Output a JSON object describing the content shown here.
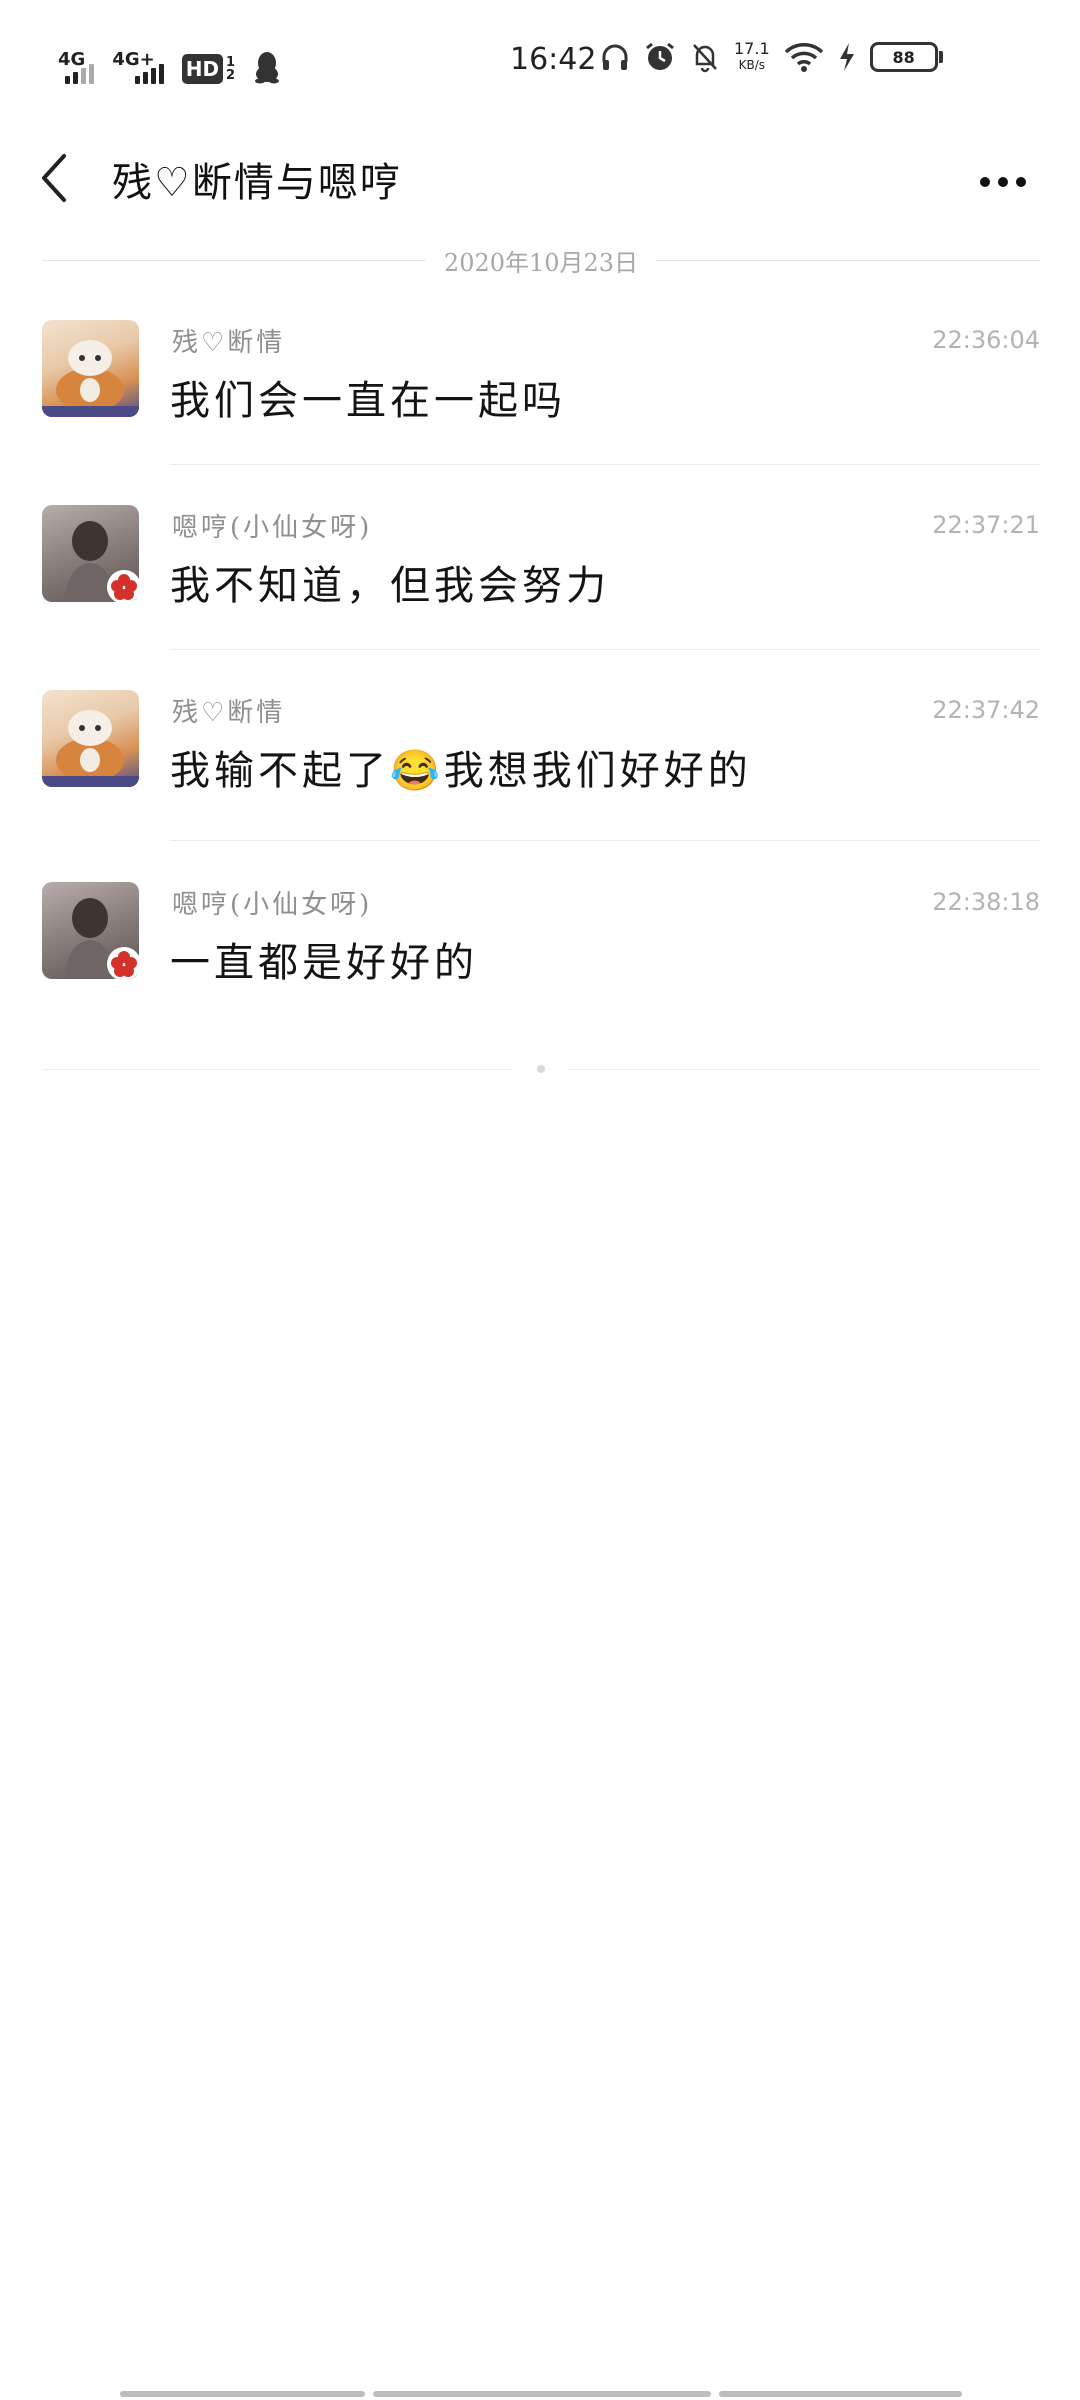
{
  "status_bar": {
    "sim1_label": "4G",
    "sim2_label": "4G+",
    "hd_label": "HD",
    "hd_sub_top": "1",
    "hd_sub_bottom": "2",
    "time": "16:42",
    "speed_value": "17.1",
    "speed_unit": "KB/s",
    "battery_level": "88"
  },
  "header": {
    "title": "残♡断情与嗯哼"
  },
  "date_divider": "2020年10月23日",
  "messages": [
    {
      "sender": "残♡断情",
      "time": "22:36:04",
      "text": "我们会一直在一起吗"
    },
    {
      "sender": "嗯哼(小仙女呀)",
      "time": "22:37:21",
      "text": "我不知道，但我会努力"
    },
    {
      "sender": "残♡断情",
      "time": "22:37:42",
      "text": "我输不起了😂我想我们好好的"
    },
    {
      "sender": "嗯哼(小仙女呀)",
      "time": "22:38:18",
      "text": "一直都是好好的"
    }
  ],
  "icons": {
    "back": "chevron-left-icon",
    "more": "more-dots-icon",
    "qq": "qq-penguin-icon",
    "headphones": "headphones-icon",
    "alarm": "alarm-icon",
    "mute": "bell-off-icon",
    "wifi": "wifi-icon",
    "charging": "lightning-icon"
  },
  "colors": {
    "background": "#ffffff",
    "text_primary": "#141414",
    "text_secondary": "#8f8f8f",
    "time": "#b3b3b3",
    "divider": "#ececec"
  }
}
